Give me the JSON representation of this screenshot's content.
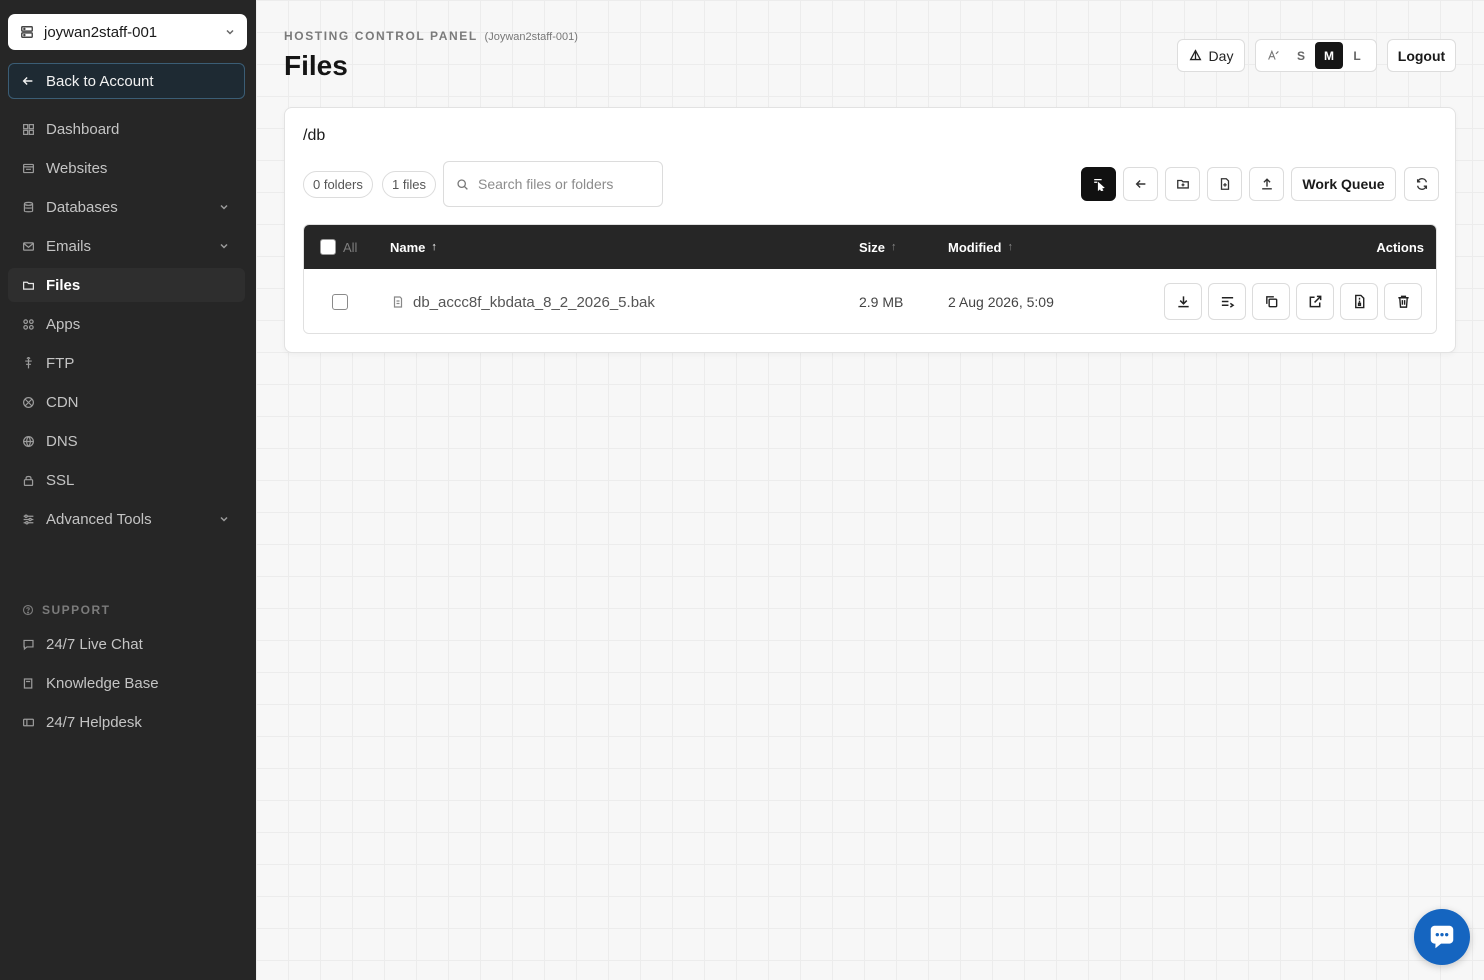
{
  "sidebar": {
    "account": "joywan2staff-001",
    "back_label": "Back to Account",
    "items": [
      {
        "label": "Dashboard"
      },
      {
        "label": "Websites"
      },
      {
        "label": "Databases"
      },
      {
        "label": "Emails"
      },
      {
        "label": "Files"
      },
      {
        "label": "Apps"
      },
      {
        "label": "FTP"
      },
      {
        "label": "CDN"
      },
      {
        "label": "DNS"
      },
      {
        "label": "SSL"
      },
      {
        "label": "Advanced Tools"
      }
    ],
    "active_item": "Files",
    "support_heading": "SUPPORT",
    "support_items": [
      {
        "label": "24/7 Live Chat"
      },
      {
        "label": "Knowledge Base"
      },
      {
        "label": "24/7 Helpdesk"
      }
    ]
  },
  "header": {
    "kicker": "HOSTING CONTROL PANEL",
    "kicker_sub": "(Joywan2staff-001)",
    "title": "Files",
    "day_label": "Day",
    "sizes": [
      "S",
      "M",
      "L"
    ],
    "selected_size": "M",
    "logout_label": "Logout"
  },
  "files": {
    "path": "/db",
    "folders_count": "0 folders",
    "files_count": "1 files",
    "search_placeholder": "Search files or folders",
    "work_queue_label": "Work Queue",
    "columns": {
      "all": "All",
      "name": "Name",
      "size": "Size",
      "modified": "Modified",
      "actions": "Actions"
    },
    "rows": [
      {
        "name": "db_accc8f_kbdata_8_2_2026_5.bak",
        "size": "2.9 MB",
        "modified": "2 Aug 2026, 5:09"
      }
    ]
  },
  "colors": {
    "sidebar_bg": "#262626",
    "accent_dark": "#111111",
    "chat_fab": "#1565c0"
  }
}
